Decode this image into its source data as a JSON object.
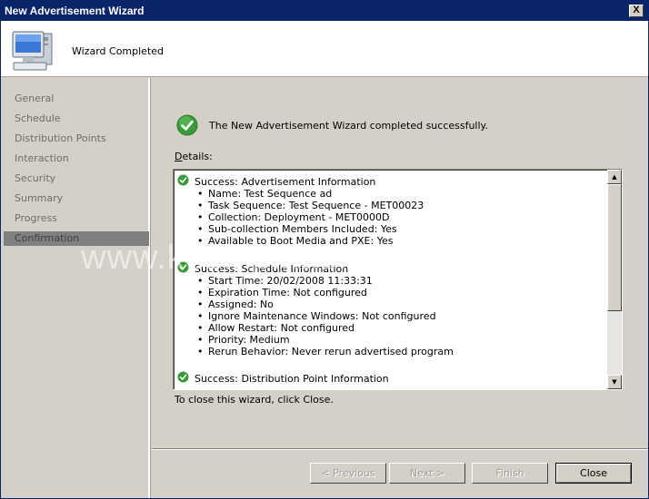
{
  "window": {
    "title": "New Advertisement Wizard",
    "close_glyph": "X"
  },
  "header": {
    "title": "Wizard Completed",
    "icon": "computer-icon"
  },
  "sidebar": {
    "items": [
      {
        "label": "General"
      },
      {
        "label": "Schedule"
      },
      {
        "label": "Distribution Points"
      },
      {
        "label": "Interaction"
      },
      {
        "label": "Security"
      },
      {
        "label": "Summary"
      },
      {
        "label": "Progress"
      },
      {
        "label": "Confirmation"
      }
    ],
    "active_index": 7
  },
  "main": {
    "success_message": "The New Advertisement Wizard completed successfully.",
    "details_label_accel": "D",
    "details_label_rest": "etails:",
    "close_note": "To close this wizard, click Close."
  },
  "details": {
    "sections": [
      {
        "heading": "Success: Advertisement Information",
        "items": [
          "Name: Test Sequence ad",
          "Task Sequence: Test Sequence - MET00023",
          "Collection: Deployment - MET0000D",
          "Sub-collection Members Included: Yes",
          "Available to Boot Media and PXE: Yes"
        ]
      },
      {
        "heading": "Success: Schedule Information",
        "items": [
          "Start Time: 20/02/2008 11:33:31",
          "Expiration Time: Not configured",
          "Assigned: No",
          "Ignore Maintenance Windows: Not configured",
          "Allow Restart: Not configured",
          "Priority: Medium",
          "Rerun Behavior: Never rerun advertised program"
        ]
      },
      {
        "heading": "Success: Distribution Point Information",
        "items": []
      }
    ]
  },
  "buttons": {
    "previous": "< Previous",
    "next": "Next >",
    "finish": "Finish",
    "close": "Close"
  },
  "watermark": "www.kozinpikas.com/itblog",
  "colors": {
    "titlebar": "#0a246a",
    "success": "#3a9a3a",
    "active_item": "#808080"
  }
}
